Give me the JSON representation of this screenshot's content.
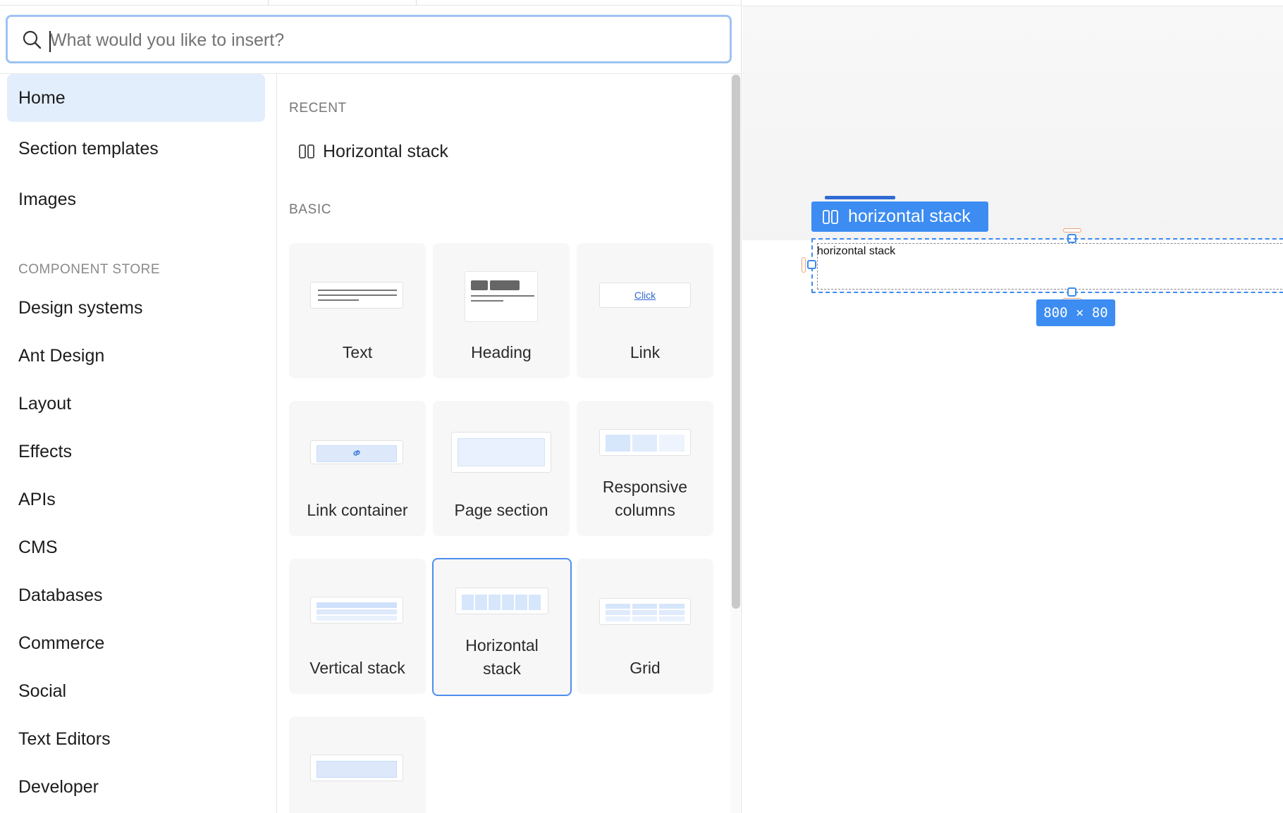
{
  "search": {
    "placeholder": "What would you like to insert?",
    "value": ""
  },
  "nav": {
    "items": [
      {
        "label": "Home",
        "active": true
      },
      {
        "label": "Section templates"
      },
      {
        "label": "Images"
      }
    ],
    "store_heading": "COMPONENT STORE",
    "store_items": [
      {
        "label": "Design systems"
      },
      {
        "label": "Ant Design"
      },
      {
        "label": "Layout"
      },
      {
        "label": "Effects"
      },
      {
        "label": "APIs"
      },
      {
        "label": "CMS"
      },
      {
        "label": "Databases"
      },
      {
        "label": "Commerce"
      },
      {
        "label": "Social"
      },
      {
        "label": "Text Editors"
      },
      {
        "label": "Developer"
      }
    ]
  },
  "content": {
    "recent_heading": "RECENT",
    "recent_items": [
      {
        "label": "Horizontal stack",
        "icon": "columns-icon"
      }
    ],
    "basic_heading": "BASIC",
    "cards": [
      {
        "label": "Text",
        "icon": "text-lines-icon"
      },
      {
        "label": "Heading",
        "icon": "heading-icon"
      },
      {
        "label": "Link",
        "icon": "link-text-icon",
        "thumb_text": "Click"
      },
      {
        "label": "Link container",
        "icon": "link-container-icon"
      },
      {
        "label": "Page section",
        "icon": "page-section-icon"
      },
      {
        "label": "Responsive columns",
        "icon": "responsive-columns-icon"
      },
      {
        "label": "Vertical stack",
        "icon": "vertical-stack-icon"
      },
      {
        "label": "Horizontal stack",
        "icon": "horizontal-stack-icon",
        "selected": true
      },
      {
        "label": "Grid",
        "icon": "grid-icon"
      },
      {
        "label": "",
        "icon": "box-icon"
      }
    ]
  },
  "canvas": {
    "badge_label": "horizontal stack",
    "element_text": "horizontal stack",
    "dimensions": "800 × 80"
  },
  "colors": {
    "accent": "#3c8cf2",
    "active_nav_bg": "#e3eefc",
    "search_focus": "#9fc3f3"
  }
}
